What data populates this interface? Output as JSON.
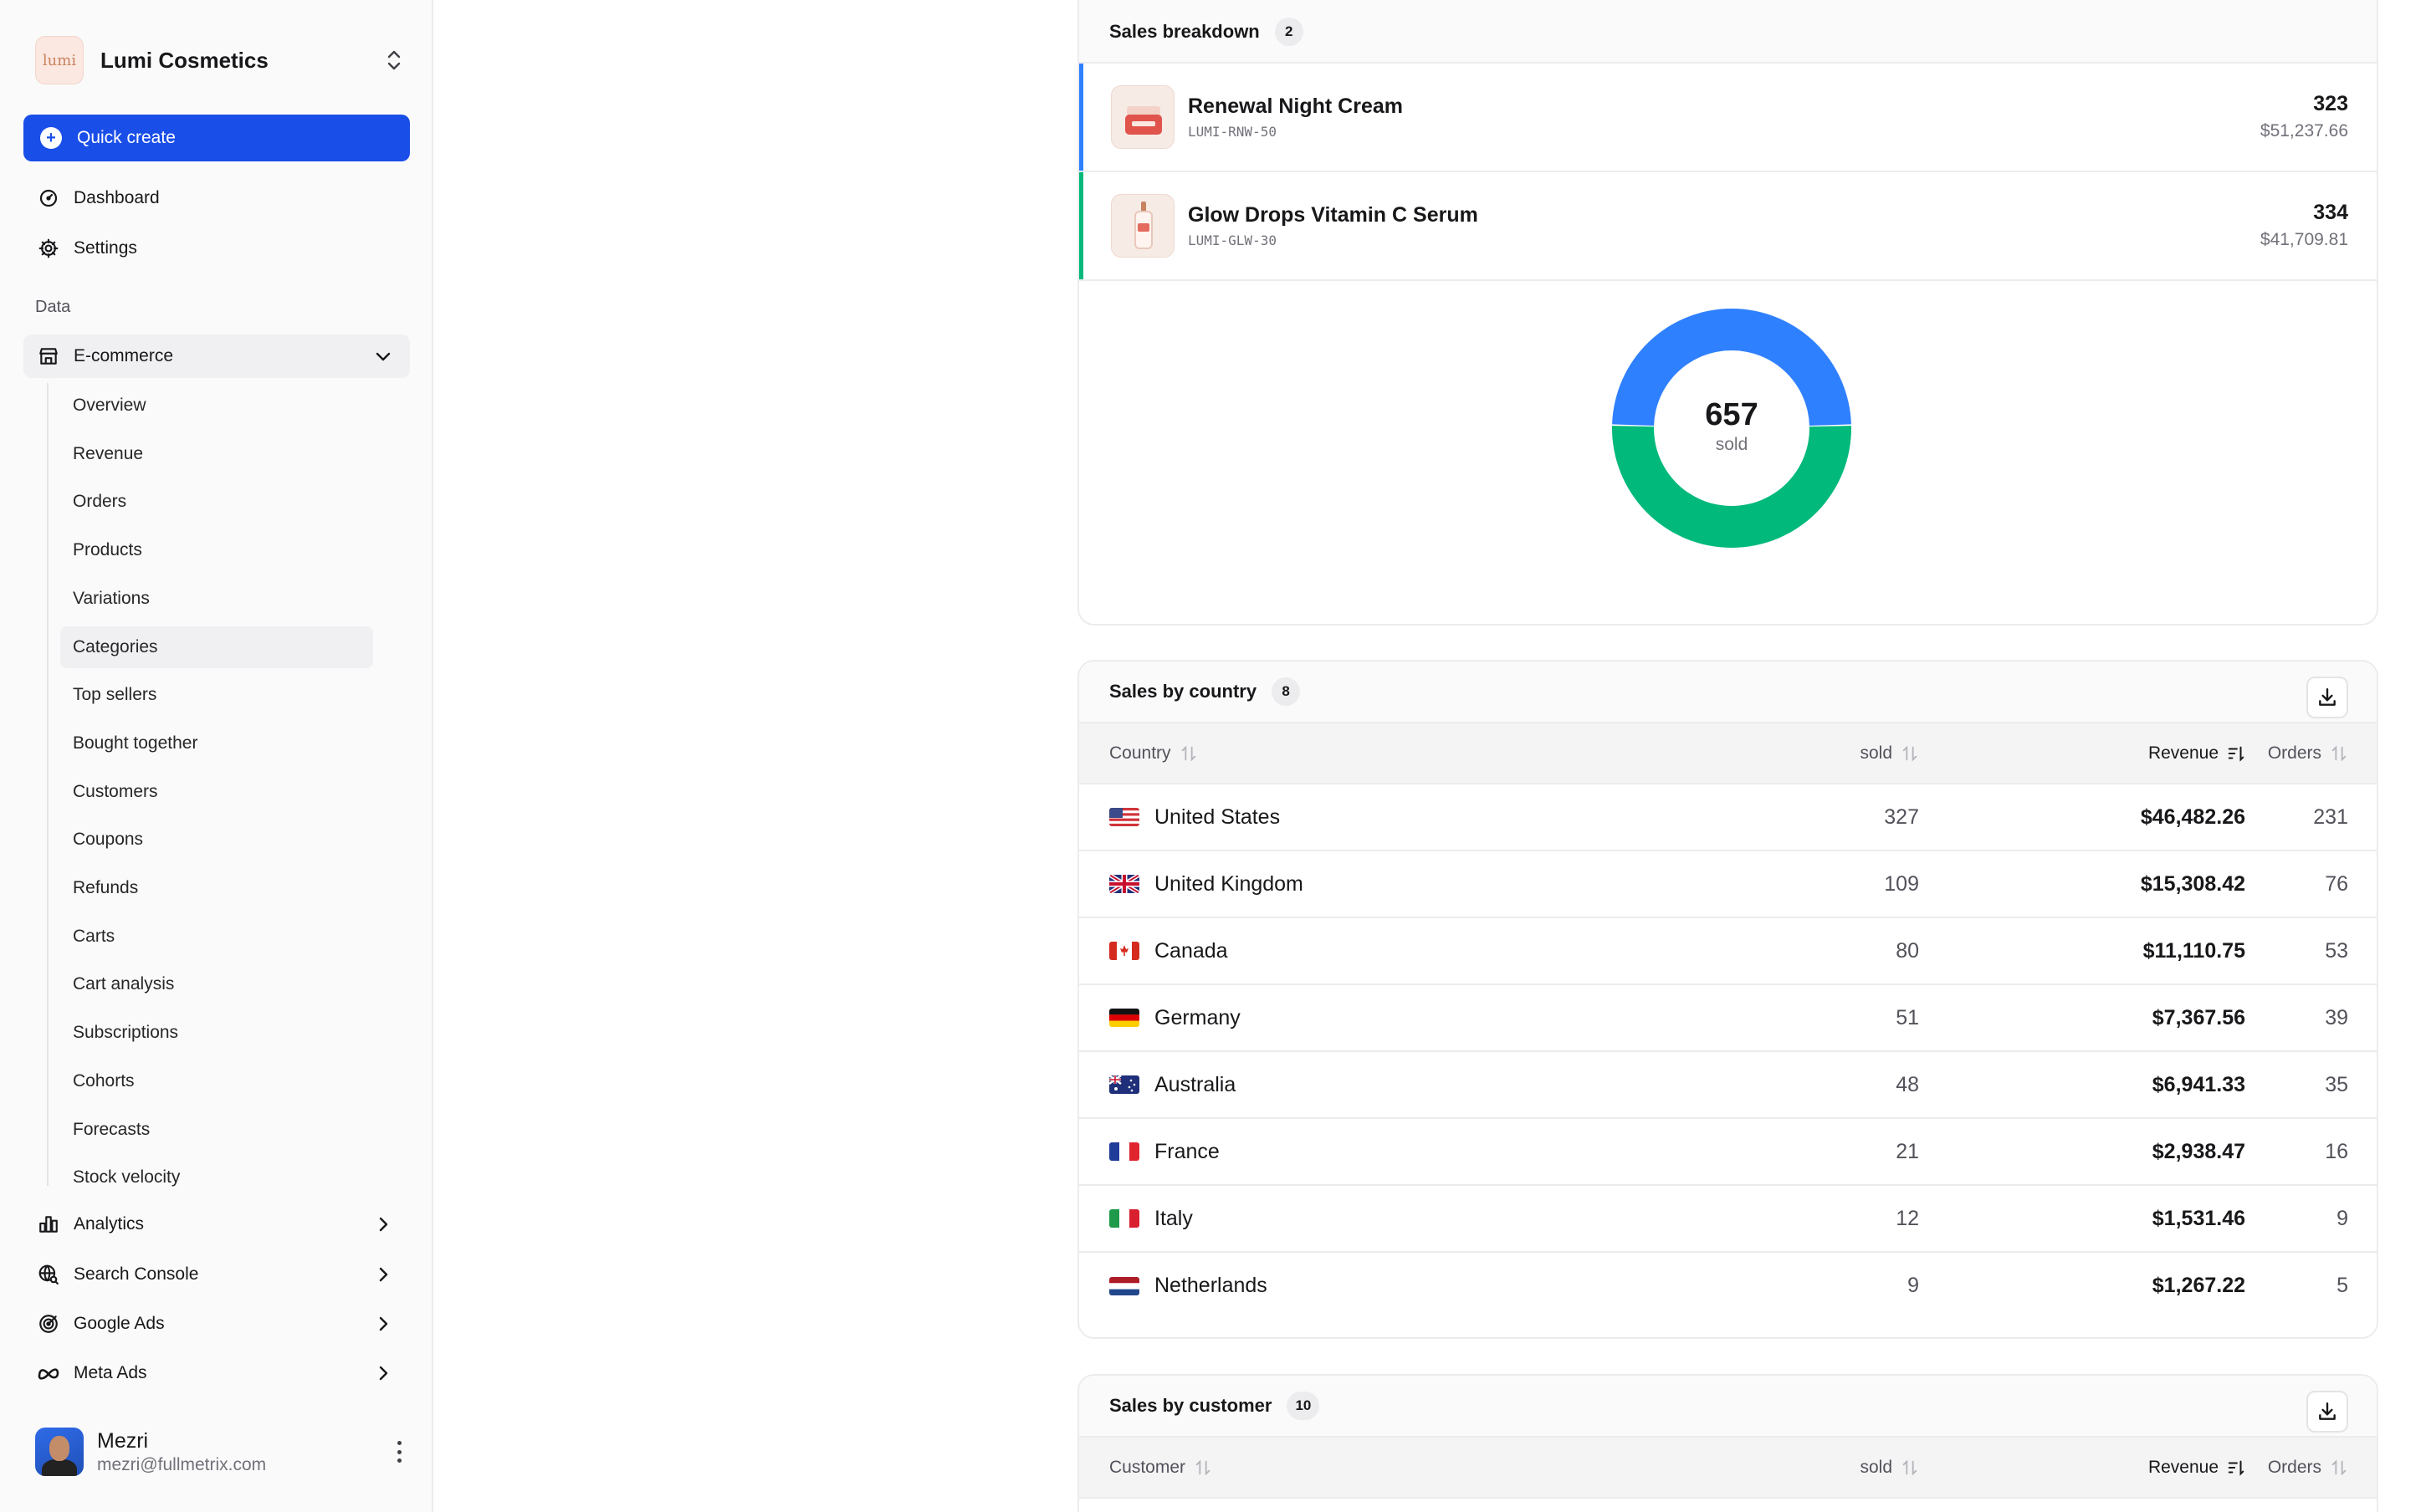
{
  "brand": {
    "logo_text": "lumi",
    "name": "Lumi Cosmetics"
  },
  "quick_create": "Quick create",
  "nav_top": [
    {
      "label": "Dashboard",
      "icon": "dashboard-icon"
    },
    {
      "label": "Settings",
      "icon": "gear-icon"
    }
  ],
  "section_label": "Data",
  "ecommerce": {
    "label": "E-commerce",
    "items": [
      "Overview",
      "Revenue",
      "Orders",
      "Products",
      "Variations",
      "Categories",
      "Top sellers",
      "Bought together",
      "Customers",
      "Coupons",
      "Refunds",
      "Carts",
      "Cart analysis",
      "Subscriptions",
      "Cohorts",
      "Forecasts",
      "Stock velocity"
    ],
    "active": "Categories"
  },
  "nav_bottom": [
    {
      "label": "Analytics",
      "icon": "bar-chart-icon"
    },
    {
      "label": "Search Console",
      "icon": "globe-search-icon"
    },
    {
      "label": "Google Ads",
      "icon": "target-icon"
    },
    {
      "label": "Meta Ads",
      "icon": "meta-icon"
    }
  ],
  "user": {
    "name": "Mezri",
    "email": "mezri@fullmetrix.com"
  },
  "sales_breakdown": {
    "title": "Sales breakdown",
    "count": "2",
    "products": [
      {
        "name": "Renewal Night Cream",
        "sku": "LUMI-RNW-50",
        "qty": "323",
        "revenue": "$51,237.66",
        "color": "#2f80ff"
      },
      {
        "name": "Glow Drops Vitamin C Serum",
        "sku": "LUMI-GLW-30",
        "qty": "334",
        "revenue": "$41,709.81",
        "color": "#00b97a"
      }
    ],
    "total": "657",
    "total_label": "sold"
  },
  "chart_data": {
    "type": "pie",
    "categories": [
      "Renewal Night Cream",
      "Glow Drops Vitamin C Serum"
    ],
    "values": [
      323,
      334
    ],
    "colors": [
      "#2f80ff",
      "#00b97a"
    ],
    "center_value": 657,
    "center_label": "sold"
  },
  "sales_by_country": {
    "title": "Sales by country",
    "count": "8",
    "columns": {
      "country": "Country",
      "sold": "sold",
      "revenue": "Revenue",
      "orders": "Orders"
    },
    "rows": [
      {
        "country": "United States",
        "flag": "us",
        "sold": "327",
        "revenue": "$46,482.26",
        "orders": "231"
      },
      {
        "country": "United Kingdom",
        "flag": "gb",
        "sold": "109",
        "revenue": "$15,308.42",
        "orders": "76"
      },
      {
        "country": "Canada",
        "flag": "ca",
        "sold": "80",
        "revenue": "$11,110.75",
        "orders": "53"
      },
      {
        "country": "Germany",
        "flag": "de",
        "sold": "51",
        "revenue": "$7,367.56",
        "orders": "39"
      },
      {
        "country": "Australia",
        "flag": "au",
        "sold": "48",
        "revenue": "$6,941.33",
        "orders": "35"
      },
      {
        "country": "France",
        "flag": "fr",
        "sold": "21",
        "revenue": "$2,938.47",
        "orders": "16"
      },
      {
        "country": "Italy",
        "flag": "it",
        "sold": "12",
        "revenue": "$1,531.46",
        "orders": "9"
      },
      {
        "country": "Netherlands",
        "flag": "nl",
        "sold": "9",
        "revenue": "$1,267.22",
        "orders": "5"
      }
    ]
  },
  "sales_by_customer": {
    "title": "Sales by customer",
    "count": "10",
    "columns": {
      "customer": "Customer",
      "sold": "sold",
      "revenue": "Revenue",
      "orders": "Orders"
    }
  }
}
